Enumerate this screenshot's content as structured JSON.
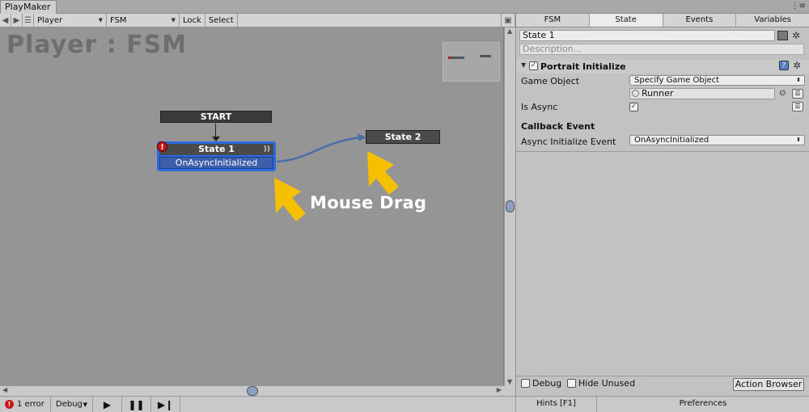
{
  "window": {
    "tab_label": "PlayMaker",
    "menu_icon": "window-menu-icon"
  },
  "toolbar": {
    "back_icon": "◀",
    "forward_icon": "▶",
    "menu_icon": "☰",
    "gameobject_value": "Player",
    "fsm_value": "FSM",
    "lock_label": "Lock",
    "select_label": "Select"
  },
  "graph": {
    "title": "Player : FSM",
    "start_label": "START",
    "state1": {
      "name": "State 1",
      "event": "OnAsyncInitialized",
      "error_icon": "!"
    },
    "state2": {
      "name": "State 2"
    },
    "annotation": "Mouse Drag",
    "annotation_color": "#f5c000",
    "transition_color": "#4a6fa8"
  },
  "status": {
    "error_count": "1 error",
    "debug_label": "Debug",
    "play_icon": "▶",
    "pause_icon": "❚❚",
    "step_icon": "▶❙"
  },
  "inspector": {
    "tabs": [
      {
        "label": "FSM"
      },
      {
        "label": "State"
      },
      {
        "label": "Events"
      },
      {
        "label": "Variables"
      }
    ],
    "active_tab": "State",
    "state_name": "State 1",
    "description_placeholder": "Description...",
    "action": {
      "enabled": true,
      "title": "Portrait Initialize",
      "help_icon": "?",
      "game_object_label": "Game Object",
      "game_object_option": "Specify Game Object",
      "runner_value": "Runner",
      "is_async_label": "Is Async",
      "is_async_checked": true,
      "callback_title": "Callback Event",
      "async_event_label": "Async Initialize Event",
      "async_event_value": "OnAsyncInitialized"
    },
    "bottom": {
      "debug_label": "Debug",
      "hide_unused_label": "Hide Unused",
      "action_browser_label": "Action Browser"
    }
  },
  "footer": {
    "hints_label": "Hints [F1]",
    "preferences_label": "Preferences"
  }
}
